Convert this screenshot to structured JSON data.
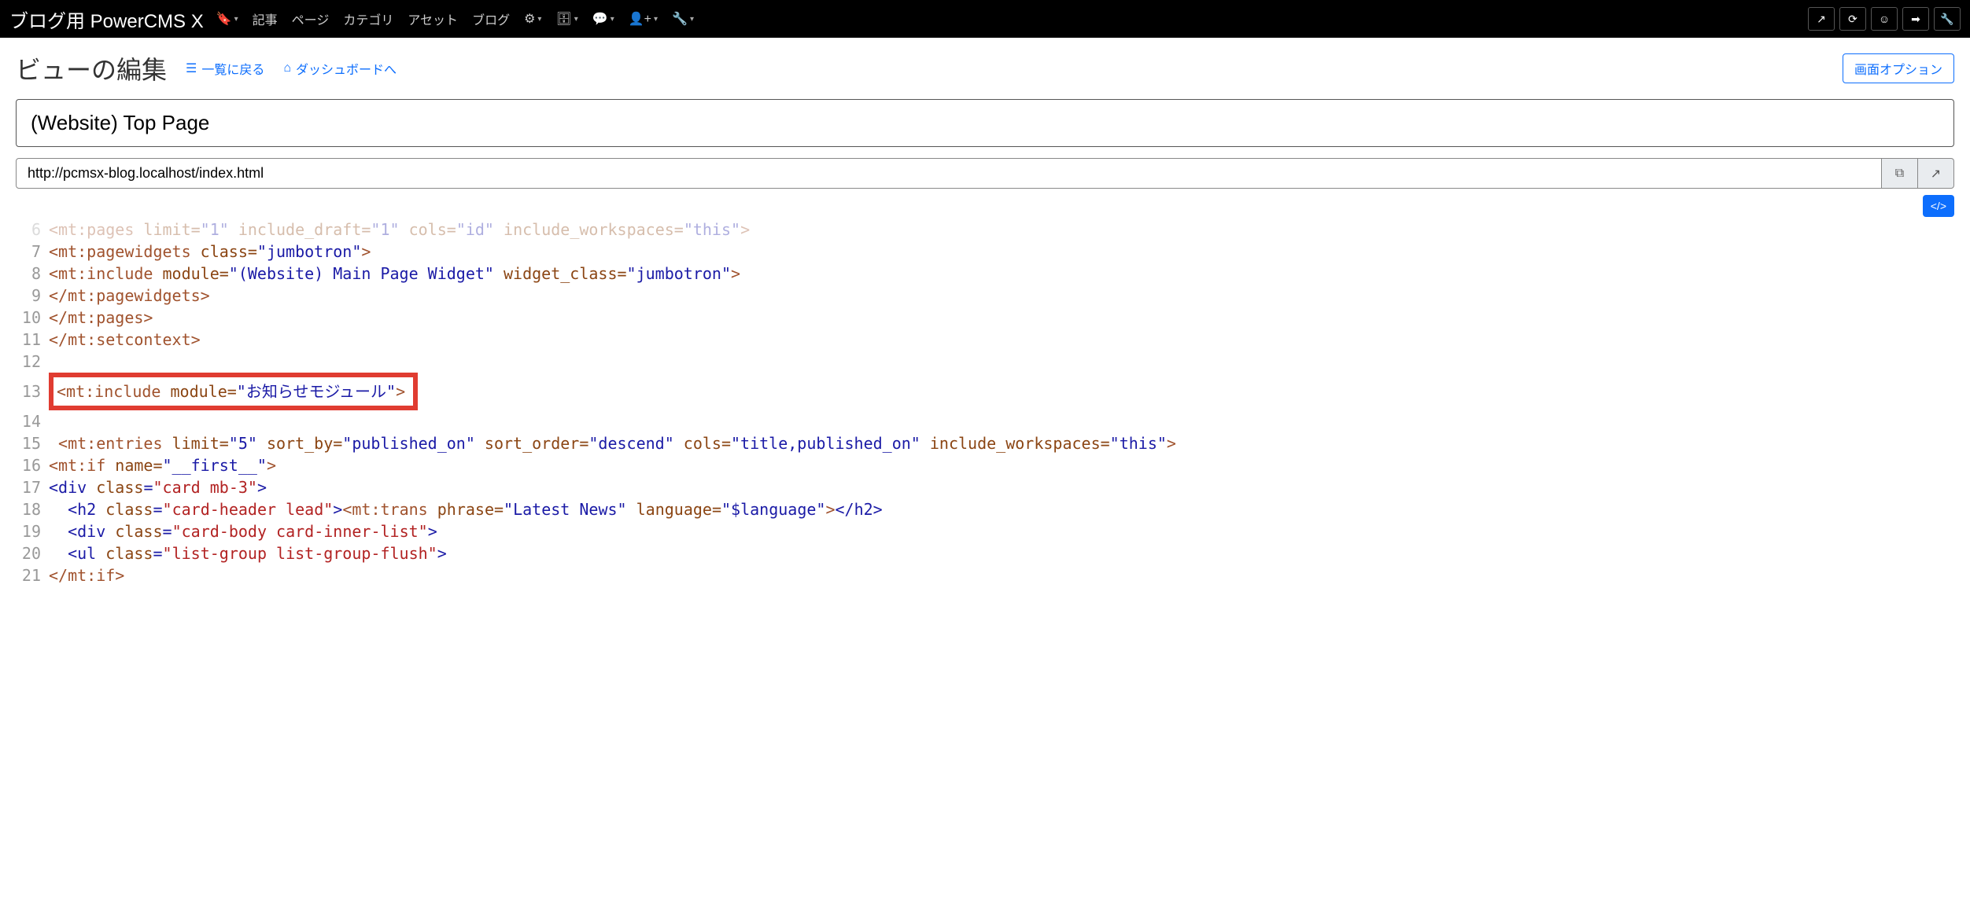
{
  "brand": "ブログ用 PowerCMS X",
  "nav": {
    "articles": "記事",
    "pages": "ページ",
    "categories": "カテゴリ",
    "assets": "アセット",
    "blog": "ブログ"
  },
  "page_title": "ビューの編集",
  "back_to_list": "一覧に戻る",
  "to_dashboard": "ダッシュボードへ",
  "screen_options": "画面オプション",
  "view_title_value": "(Website) Top Page",
  "url_value": "http://pcmsx-blog.localhost/index.html",
  "code_lines": {
    "6": "<mt:pages limit=\"1\" include_draft=\"1\" cols=\"id\" include_workspaces=\"this\">",
    "7": "<mt:pagewidgets class=\"jumbotron\">",
    "8": "<mt:include module=\"(Website) Main Page Widget\" widget_class=\"jumbotron\">",
    "9": "</mt:pagewidgets>",
    "10": "</mt:pages>",
    "11": "</mt:setcontext>",
    "12": "",
    "13": "<mt:include module=\"お知らせモジュール\">",
    "14": "",
    "15": " <mt:entries limit=\"5\" sort_by=\"published_on\" sort_order=\"descend\" cols=\"title,published_on\" include_workspaces=\"this\">",
    "16": "<mt:if name=\"__first__\">",
    "17": "<div class=\"card mb-3\">",
    "18": "  <h2 class=\"card-header lead\"><mt:trans phrase=\"Latest News\" language=\"$language\"></h2>",
    "19": "  <div class=\"card-body card-inner-list\">",
    "20": "  <ul class=\"list-group list-group-flush\">",
    "21": "</mt:if>"
  }
}
